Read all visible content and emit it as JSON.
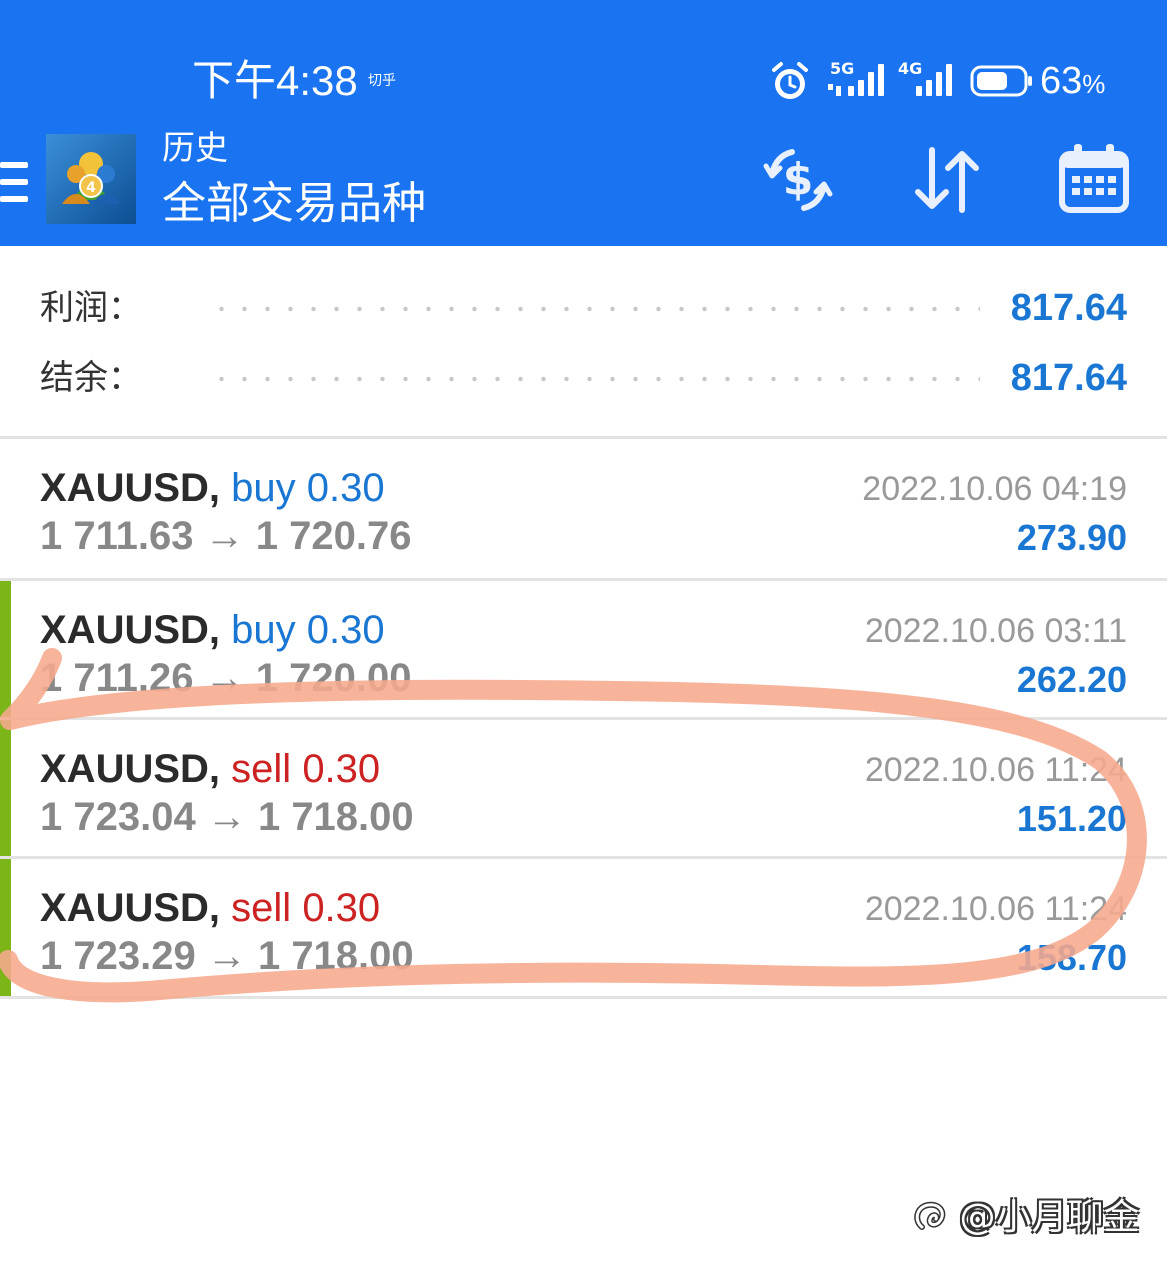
{
  "status_bar": {
    "time": "下午4:38",
    "extra_indicator": "切乎",
    "network_5g": "5G",
    "network_4g": "4G",
    "battery_percent": "63",
    "battery_unit": "%"
  },
  "header": {
    "title": "历史",
    "subtitle": "全部交易品种",
    "actions": [
      "currency-exchange",
      "sort",
      "calendar"
    ]
  },
  "summary": {
    "profit_label": "利润：",
    "profit_value": "817.64",
    "balance_label": "结余：",
    "balance_value": "817.64"
  },
  "trades": [
    {
      "symbol": "XAUUSD,",
      "side": "buy",
      "volume": "0.30",
      "open_price": "1 711.63",
      "arrow": "→",
      "close_price": "1 720.76",
      "time": "2022.10.06 04:19",
      "profit": "273.90"
    },
    {
      "symbol": "XAUUSD,",
      "side": "buy",
      "volume": "0.30",
      "open_price": "1 711.26",
      "arrow": "→",
      "close_price": "1 720.00",
      "time": "2022.10.06 03:11",
      "profit": "262.20"
    },
    {
      "symbol": "XAUUSD,",
      "side": "sell",
      "volume": "0.30",
      "open_price": "1 723.04",
      "arrow": "→",
      "close_price": "1 718.00",
      "time": "2022.10.06 11:24",
      "profit": "151.20"
    },
    {
      "symbol": "XAUUSD,",
      "side": "sell",
      "volume": "0.30",
      "open_price": "1 723.29",
      "arrow": "→",
      "close_price": "1 718.00",
      "time": "2022.10.06 11:24",
      "profit": "158.70"
    }
  ],
  "watermark": "@小月聊金",
  "colors": {
    "header_bg": "#1a73f0",
    "accent_blue": "#1976d2",
    "sell_red": "#cc2222",
    "side_bar_green": "#7cb518",
    "annotation_stroke": "#f7a98d"
  }
}
